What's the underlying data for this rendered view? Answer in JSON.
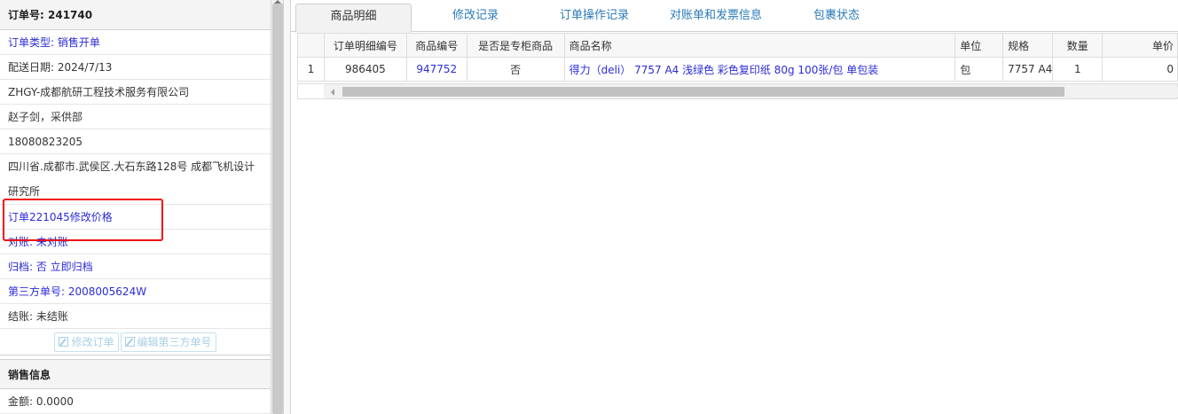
{
  "left_panel": {
    "order_no_label": "订单号:",
    "order_no": "241740",
    "order_type": "订单类型:  销售开单",
    "delivery_date": "配送日期:  2024/7/13",
    "customer": "ZHGY-成都航研工程技术服务有限公司",
    "contact": "赵子剑，采供部",
    "phone": "18080823205",
    "address": "四川省.成都市.武侯区.大石东路128号 成都飞机设计研究所",
    "note_link": "订单221045修改价格",
    "reconcile": "对账:  未对账",
    "archive": "归档:  否 立即归档",
    "third_party_no": "第三方单号:  2008005624W",
    "settlement": "结账:  未结账",
    "btn_edit_order": "修改订单",
    "btn_edit_third_party": "编辑第三方单号",
    "sales_info_header": "销售信息",
    "amount": "金额:  0.0000"
  },
  "tabs": [
    {
      "label": "商品明细",
      "active": true
    },
    {
      "label": "修改记录",
      "active": false
    },
    {
      "label": "订单操作记录",
      "active": false
    },
    {
      "label": "对账单和发票信息",
      "active": false
    },
    {
      "label": "包裹状态",
      "active": false
    }
  ],
  "table": {
    "columns": [
      "",
      "订单明细编号",
      "商品编号",
      "是否是专柜商品",
      "商品名称",
      "单位",
      "规格",
      "数量",
      "单价"
    ],
    "rows": [
      {
        "index": "1",
        "detail_no": "986405",
        "product_no": "947752",
        "is_counter": "否",
        "product_name": "得力（deli） 7757 A4 浅绿色 彩色复印纸 80g 100张/包 单包装",
        "unit": "包",
        "spec": "7757 A4",
        "qty": "1",
        "price": "0"
      }
    ]
  },
  "colors": {
    "link_blue": "#2b2bd8",
    "tab_blue": "#2a7ab8",
    "highlight_red": "#ee1111"
  }
}
